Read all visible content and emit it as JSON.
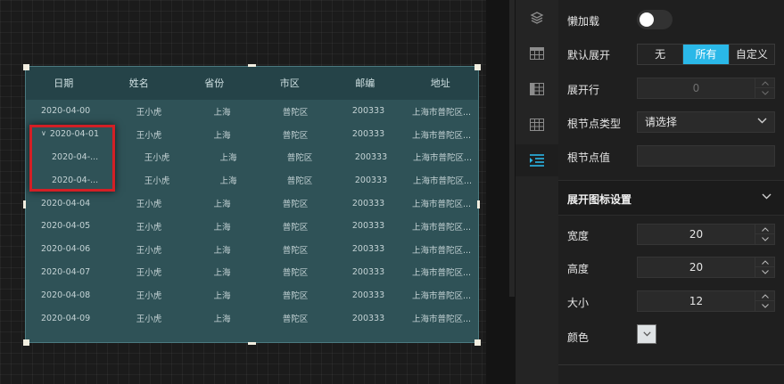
{
  "table": {
    "columns": [
      "日期",
      "姓名",
      "省份",
      "市区",
      "邮编",
      "地址"
    ],
    "rows": [
      {
        "date": "2020-04-00",
        "name": "王小虎",
        "province": "上海",
        "district": "普陀区",
        "zip": "200333",
        "address": "上海市普陀区...",
        "level": 0,
        "expanded": false
      },
      {
        "date": "2020-04-01",
        "name": "王小虎",
        "province": "上海",
        "district": "普陀区",
        "zip": "200333",
        "address": "上海市普陀区...",
        "level": 0,
        "expanded": true
      },
      {
        "date": "2020-04-...",
        "name": "王小虎",
        "province": "上海",
        "district": "普陀区",
        "zip": "200333",
        "address": "上海市普陀区...",
        "level": 1,
        "expanded": false
      },
      {
        "date": "2020-04-...",
        "name": "王小虎",
        "province": "上海",
        "district": "普陀区",
        "zip": "200333",
        "address": "上海市普陀区...",
        "level": 1,
        "expanded": false
      },
      {
        "date": "2020-04-04",
        "name": "王小虎",
        "province": "上海",
        "district": "普陀区",
        "zip": "200333",
        "address": "上海市普陀区...",
        "level": 0,
        "expanded": false
      },
      {
        "date": "2020-04-05",
        "name": "王小虎",
        "province": "上海",
        "district": "普陀区",
        "zip": "200333",
        "address": "上海市普陀区...",
        "level": 0,
        "expanded": false
      },
      {
        "date": "2020-04-06",
        "name": "王小虎",
        "province": "上海",
        "district": "普陀区",
        "zip": "200333",
        "address": "上海市普陀区...",
        "level": 0,
        "expanded": false
      },
      {
        "date": "2020-04-07",
        "name": "王小虎",
        "province": "上海",
        "district": "普陀区",
        "zip": "200333",
        "address": "上海市普陀区...",
        "level": 0,
        "expanded": false
      },
      {
        "date": "2020-04-08",
        "name": "王小虎",
        "province": "上海",
        "district": "普陀区",
        "zip": "200333",
        "address": "上海市普陀区...",
        "level": 0,
        "expanded": false
      },
      {
        "date": "2020-04-09",
        "name": "王小虎",
        "province": "上海",
        "district": "普陀区",
        "zip": "200333",
        "address": "上海市普陀区...",
        "level": 0,
        "expanded": false
      }
    ]
  },
  "rail": {
    "icons": [
      "layers-icon",
      "table-icon",
      "table-columns-icon",
      "table-grid-icon",
      "tree-indent-icon"
    ],
    "active_index": 4
  },
  "panel": {
    "lazy_load_label": "懒加载",
    "lazy_load_on": false,
    "default_expand_label": "默认展开",
    "default_expand_options": [
      "无",
      "所有",
      "自定义"
    ],
    "default_expand_selected": "所有",
    "expand_row_label": "展开行",
    "expand_row_value": "0",
    "root_type_label": "根节点类型",
    "root_type_placeholder": "请选择",
    "root_value_label": "根节点值",
    "root_value": "",
    "expand_icon_section": "展开图标设置",
    "width_label": "宽度",
    "width_value": "20",
    "height_label": "高度",
    "height_value": "20",
    "size_label": "大小",
    "size_value": "12",
    "color_label": "颜色",
    "icon_color": "#dfe3e5"
  },
  "colors": {
    "accent": "#2ab8e8",
    "table_bg": "#2f5257",
    "table_header_bg": "#254348",
    "highlight": "#d31f25"
  }
}
